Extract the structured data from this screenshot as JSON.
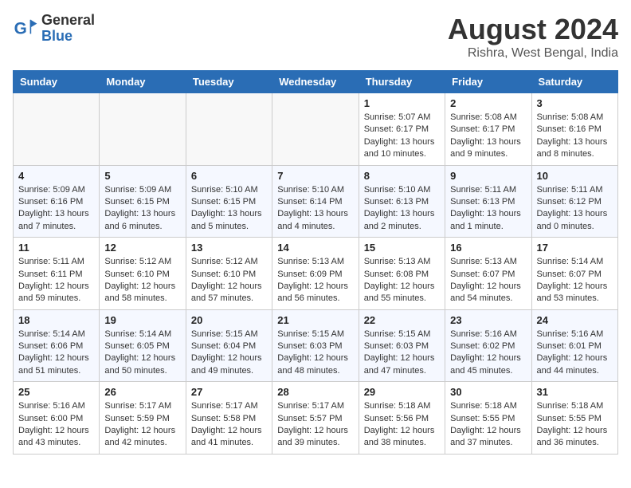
{
  "header": {
    "logo_general": "General",
    "logo_blue": "Blue",
    "title": "August 2024",
    "subtitle": "Rishra, West Bengal, India"
  },
  "weekdays": [
    "Sunday",
    "Monday",
    "Tuesday",
    "Wednesday",
    "Thursday",
    "Friday",
    "Saturday"
  ],
  "weeks": [
    [
      {
        "day": "",
        "info": ""
      },
      {
        "day": "",
        "info": ""
      },
      {
        "day": "",
        "info": ""
      },
      {
        "day": "",
        "info": ""
      },
      {
        "day": "1",
        "info": "Sunrise: 5:07 AM\nSunset: 6:17 PM\nDaylight: 13 hours\nand 10 minutes."
      },
      {
        "day": "2",
        "info": "Sunrise: 5:08 AM\nSunset: 6:17 PM\nDaylight: 13 hours\nand 9 minutes."
      },
      {
        "day": "3",
        "info": "Sunrise: 5:08 AM\nSunset: 6:16 PM\nDaylight: 13 hours\nand 8 minutes."
      }
    ],
    [
      {
        "day": "4",
        "info": "Sunrise: 5:09 AM\nSunset: 6:16 PM\nDaylight: 13 hours\nand 7 minutes."
      },
      {
        "day": "5",
        "info": "Sunrise: 5:09 AM\nSunset: 6:15 PM\nDaylight: 13 hours\nand 6 minutes."
      },
      {
        "day": "6",
        "info": "Sunrise: 5:10 AM\nSunset: 6:15 PM\nDaylight: 13 hours\nand 5 minutes."
      },
      {
        "day": "7",
        "info": "Sunrise: 5:10 AM\nSunset: 6:14 PM\nDaylight: 13 hours\nand 4 minutes."
      },
      {
        "day": "8",
        "info": "Sunrise: 5:10 AM\nSunset: 6:13 PM\nDaylight: 13 hours\nand 2 minutes."
      },
      {
        "day": "9",
        "info": "Sunrise: 5:11 AM\nSunset: 6:13 PM\nDaylight: 13 hours\nand 1 minute."
      },
      {
        "day": "10",
        "info": "Sunrise: 5:11 AM\nSunset: 6:12 PM\nDaylight: 13 hours\nand 0 minutes."
      }
    ],
    [
      {
        "day": "11",
        "info": "Sunrise: 5:11 AM\nSunset: 6:11 PM\nDaylight: 12 hours\nand 59 minutes."
      },
      {
        "day": "12",
        "info": "Sunrise: 5:12 AM\nSunset: 6:10 PM\nDaylight: 12 hours\nand 58 minutes."
      },
      {
        "day": "13",
        "info": "Sunrise: 5:12 AM\nSunset: 6:10 PM\nDaylight: 12 hours\nand 57 minutes."
      },
      {
        "day": "14",
        "info": "Sunrise: 5:13 AM\nSunset: 6:09 PM\nDaylight: 12 hours\nand 56 minutes."
      },
      {
        "day": "15",
        "info": "Sunrise: 5:13 AM\nSunset: 6:08 PM\nDaylight: 12 hours\nand 55 minutes."
      },
      {
        "day": "16",
        "info": "Sunrise: 5:13 AM\nSunset: 6:07 PM\nDaylight: 12 hours\nand 54 minutes."
      },
      {
        "day": "17",
        "info": "Sunrise: 5:14 AM\nSunset: 6:07 PM\nDaylight: 12 hours\nand 53 minutes."
      }
    ],
    [
      {
        "day": "18",
        "info": "Sunrise: 5:14 AM\nSunset: 6:06 PM\nDaylight: 12 hours\nand 51 minutes."
      },
      {
        "day": "19",
        "info": "Sunrise: 5:14 AM\nSunset: 6:05 PM\nDaylight: 12 hours\nand 50 minutes."
      },
      {
        "day": "20",
        "info": "Sunrise: 5:15 AM\nSunset: 6:04 PM\nDaylight: 12 hours\nand 49 minutes."
      },
      {
        "day": "21",
        "info": "Sunrise: 5:15 AM\nSunset: 6:03 PM\nDaylight: 12 hours\nand 48 minutes."
      },
      {
        "day": "22",
        "info": "Sunrise: 5:15 AM\nSunset: 6:03 PM\nDaylight: 12 hours\nand 47 minutes."
      },
      {
        "day": "23",
        "info": "Sunrise: 5:16 AM\nSunset: 6:02 PM\nDaylight: 12 hours\nand 45 minutes."
      },
      {
        "day": "24",
        "info": "Sunrise: 5:16 AM\nSunset: 6:01 PM\nDaylight: 12 hours\nand 44 minutes."
      }
    ],
    [
      {
        "day": "25",
        "info": "Sunrise: 5:16 AM\nSunset: 6:00 PM\nDaylight: 12 hours\nand 43 minutes."
      },
      {
        "day": "26",
        "info": "Sunrise: 5:17 AM\nSunset: 5:59 PM\nDaylight: 12 hours\nand 42 minutes."
      },
      {
        "day": "27",
        "info": "Sunrise: 5:17 AM\nSunset: 5:58 PM\nDaylight: 12 hours\nand 41 minutes."
      },
      {
        "day": "28",
        "info": "Sunrise: 5:17 AM\nSunset: 5:57 PM\nDaylight: 12 hours\nand 39 minutes."
      },
      {
        "day": "29",
        "info": "Sunrise: 5:18 AM\nSunset: 5:56 PM\nDaylight: 12 hours\nand 38 minutes."
      },
      {
        "day": "30",
        "info": "Sunrise: 5:18 AM\nSunset: 5:55 PM\nDaylight: 12 hours\nand 37 minutes."
      },
      {
        "day": "31",
        "info": "Sunrise: 5:18 AM\nSunset: 5:55 PM\nDaylight: 12 hours\nand 36 minutes."
      }
    ]
  ]
}
